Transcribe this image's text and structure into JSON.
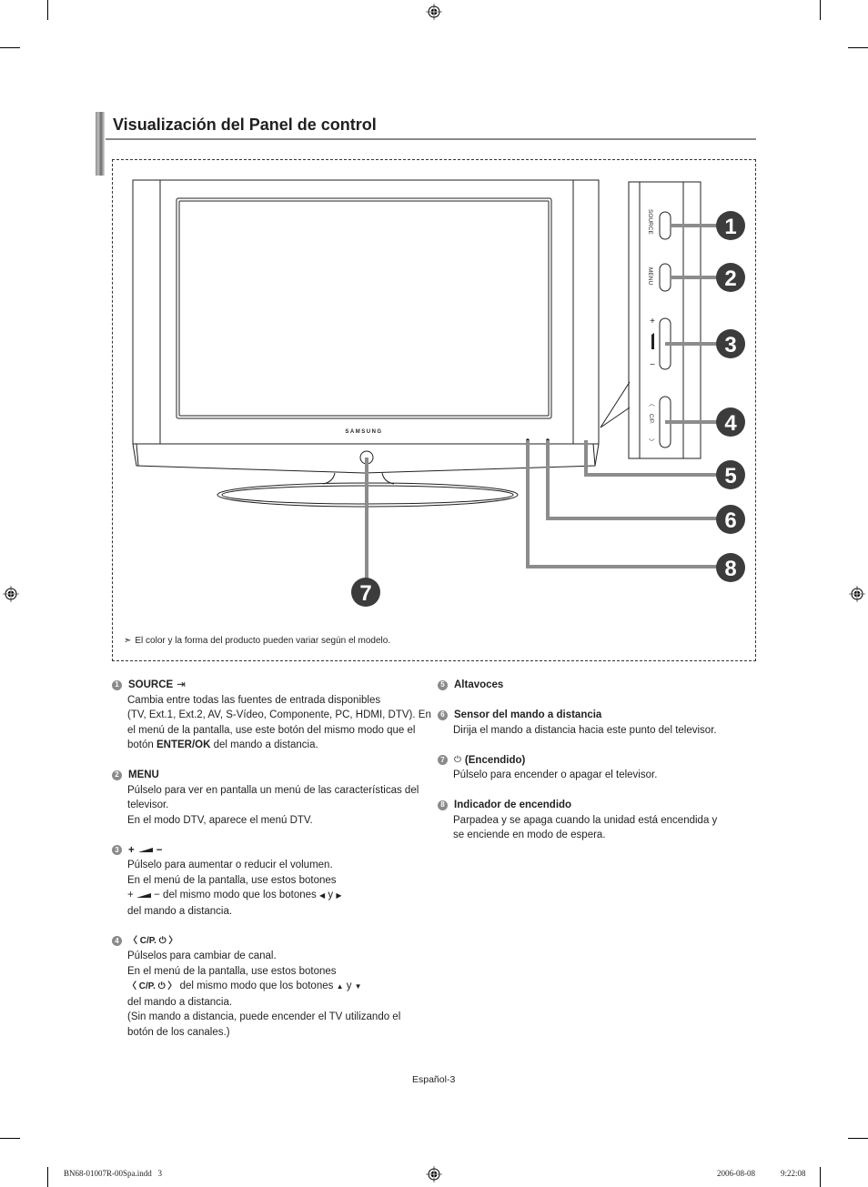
{
  "section_title": "Visualización del Panel de control",
  "figure": {
    "brand_label": "SAMSUNG",
    "side_panel": {
      "source_label": "SOURCE",
      "menu_label": "MENU",
      "vol_plus": "+",
      "vol_minus": "−",
      "ch_up": "〈",
      "ch_label": "C/P.",
      "ch_down": "〉"
    },
    "callouts": [
      "1",
      "2",
      "3",
      "4",
      "5",
      "6",
      "7",
      "8"
    ],
    "note": "El color y la forma del producto pueden variar según el modelo."
  },
  "items_left": [
    {
      "num": "1",
      "title": "SOURCE",
      "lines": [
        "Cambia entre todas las fuentes de entrada disponibles",
        "(TV, Ext.1, Ext.2, AV, S-Vídeo, Componente, PC, HDMI, DTV). En",
        "el menú de la pantalla, use este botón del mismo modo que el"
      ],
      "last_pre": "botón ",
      "last_bold": "ENTER/OK",
      "last_post": " del mando a distancia."
    },
    {
      "num": "2",
      "title": "MENU",
      "lines": [
        "Púlselo para ver en pantalla un menú de las características del",
        "televisor.",
        "En el modo DTV, aparece el menú DTV."
      ]
    },
    {
      "num": "3",
      "title_plus": "+",
      "title_minus": "−",
      "lines": [
        "Púlselo para aumentar o reducir el volumen.",
        "En el menú de la pantalla, use estos botones"
      ],
      "inline_text": "del mismo modo que los botones",
      "inline_y": "y",
      "tail": "del mando a distancia."
    },
    {
      "num": "4",
      "title_sym": "〈 C/P. ⏻ 〉",
      "lines": [
        "Púlselos para cambiar de canal.",
        "En el menú de la pantalla, use estos botones"
      ],
      "inline_text": "del mismo modo que los botones",
      "inline_y": "y",
      "tail_lines": [
        "del mando a distancia.",
        "(Sin mando a distancia, puede encender el TV utilizando el",
        "botón de los canales.)"
      ]
    }
  ],
  "items_right": [
    {
      "num": "5",
      "title": "Altavoces",
      "lines": []
    },
    {
      "num": "6",
      "title": "Sensor del mando a distancia",
      "lines": [
        "Dirija el mando a distancia hacia este punto del televisor."
      ]
    },
    {
      "num": "7",
      "title_icon": "⏻",
      "title": "(Encendido)",
      "lines": [
        "Púlselo para encender o apagar el televisor."
      ]
    },
    {
      "num": "8",
      "title": "Indicador de encendido",
      "lines": [
        "Parpadea y se apaga cuando la unidad está encendida y",
        "se enciende en modo de espera."
      ]
    }
  ],
  "footer": {
    "page_label": "Español-3",
    "slug_file": "BN68-01007R-00Spa.indd   3",
    "slug_date": "2006-08-08",
    "slug_time": "9:22:08"
  }
}
